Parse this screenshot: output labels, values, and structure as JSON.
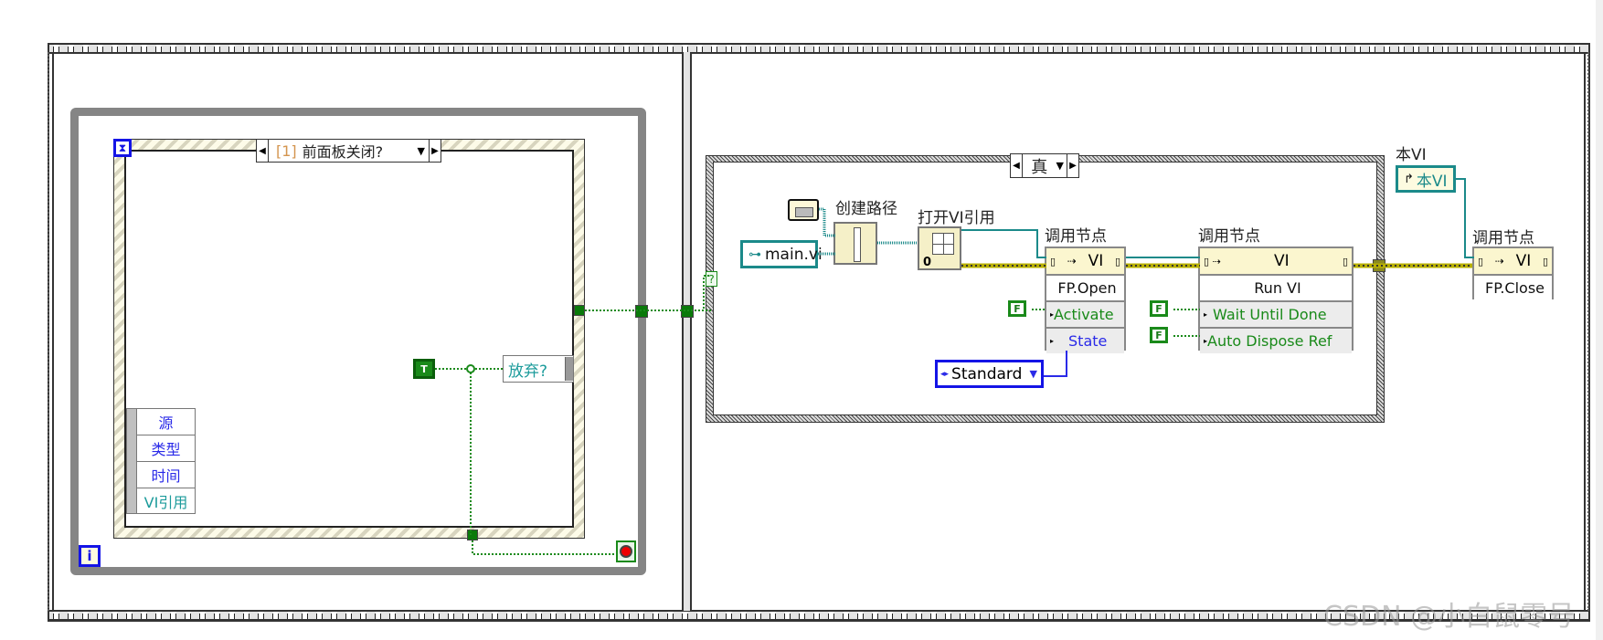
{
  "diagram": {
    "sequence_frames": 2,
    "frame1": {
      "while_loop": {
        "iteration_terminal": "i",
        "stop_terminal": "stop-if-true"
      },
      "event_structure": {
        "timeout_terminal": "hourglass",
        "selector_index": "[1]",
        "selector_label": "前面板关闭?",
        "event_data_items": [
          "源",
          "类型",
          "时间",
          "VI引用"
        ],
        "discard_indicator": "放弃?",
        "true_constant": "T"
      }
    },
    "frame2": {
      "case_structure": {
        "selector_label": "真",
        "selector_terminal": "?"
      },
      "path_constant": "main.vi",
      "folder_constant_icon": "folder-icon",
      "build_path_label": "创建路径",
      "open_vi_ref_label": "打开VI引用",
      "open_vi_ref_options": "0",
      "invoke_nodes": [
        {
          "label": "调用节点",
          "class": "VI",
          "method": "FP.Open",
          "params": [
            {
              "name": "Activate",
              "value": "F",
              "color": "#1a8a1a"
            },
            {
              "name": "State",
              "color": "#2a2ae8"
            }
          ]
        },
        {
          "label": "调用节点",
          "class": "VI",
          "method": "Run VI",
          "params": [
            {
              "name": "Wait Until Done",
              "value": "F",
              "color": "#1a8a1a"
            },
            {
              "name": "Auto Dispose Ref",
              "value": "F",
              "color": "#1a8a1a"
            }
          ]
        },
        {
          "label": "调用节点",
          "class": "VI",
          "method": "FP.Close",
          "params": []
        }
      ],
      "state_enum": "Standard",
      "this_vi_label": "本VI",
      "this_vi_constant": "本VI"
    }
  },
  "colors": {
    "bool_wire": "#1a8a1a",
    "refnum_wire": "#1b8a8a",
    "error_wire": "#b8b000",
    "enum_wire": "#2a2ae8"
  },
  "watermark": "CSDN @小白鼠零号"
}
